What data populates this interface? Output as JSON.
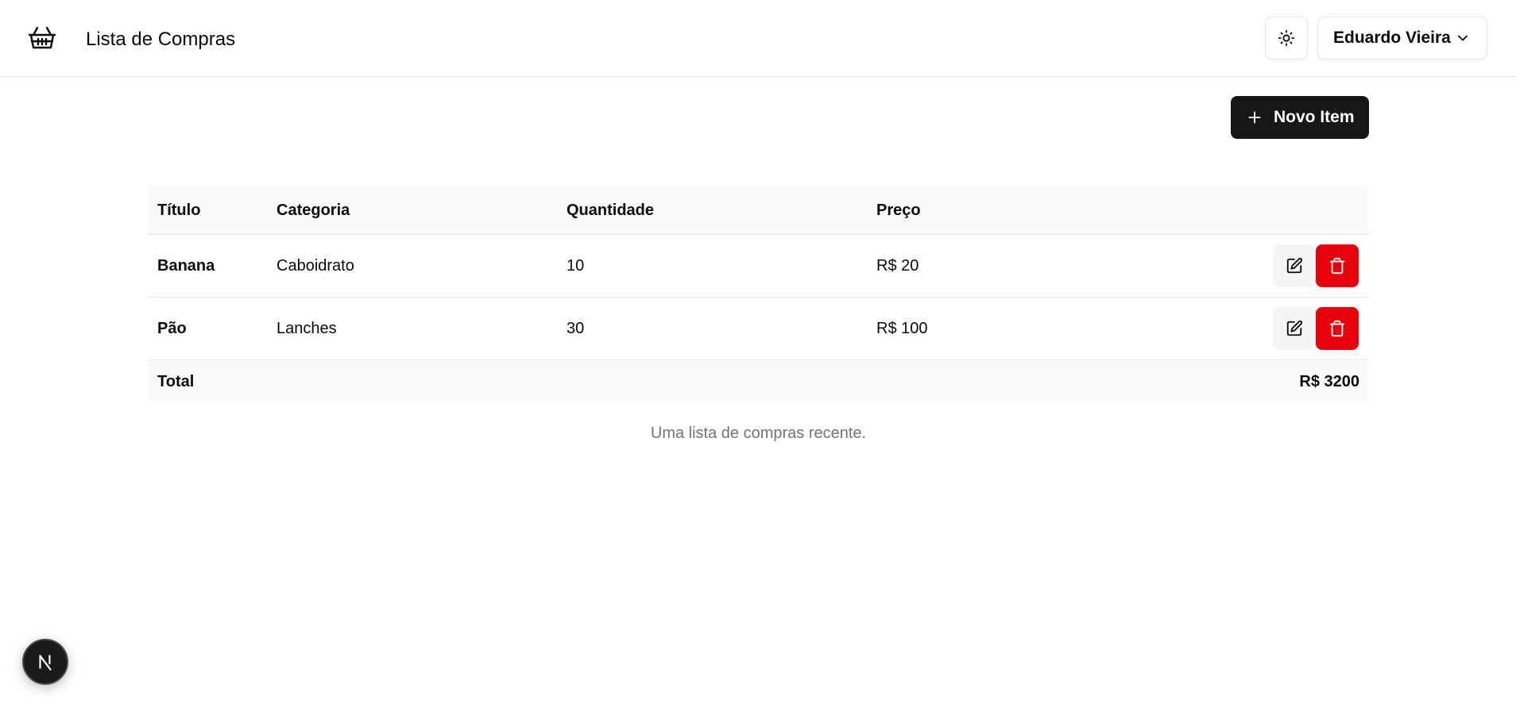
{
  "header": {
    "logo_icon": "shopping-basket-icon",
    "title": "Lista de Compras",
    "theme_icon": "sun-icon",
    "user_name": "Eduardo Vieira",
    "user_chevron_icon": "chevron-down-icon"
  },
  "toolbar": {
    "new_item_label": "Novo Item",
    "new_item_icon": "plus-icon"
  },
  "table": {
    "columns": [
      "Título",
      "Categoria",
      "Quantidade",
      "Preço"
    ],
    "rows": [
      {
        "title": "Banana",
        "category": "Caboidrato",
        "quantity": "10",
        "price": "R$ 20"
      },
      {
        "title": "Pão",
        "category": "Lanches",
        "quantity": "30",
        "price": "R$ 100"
      }
    ],
    "footer": {
      "label": "Total",
      "value": "R$ 3200"
    },
    "caption": "Uma lista de compras recente."
  },
  "colors": {
    "primary": "#171717",
    "destructive": "#e7000b",
    "muted_text": "#737373",
    "border": "#e5e5e5"
  },
  "dev_badge": {
    "letter": "N",
    "icon": "nextjs-icon"
  }
}
